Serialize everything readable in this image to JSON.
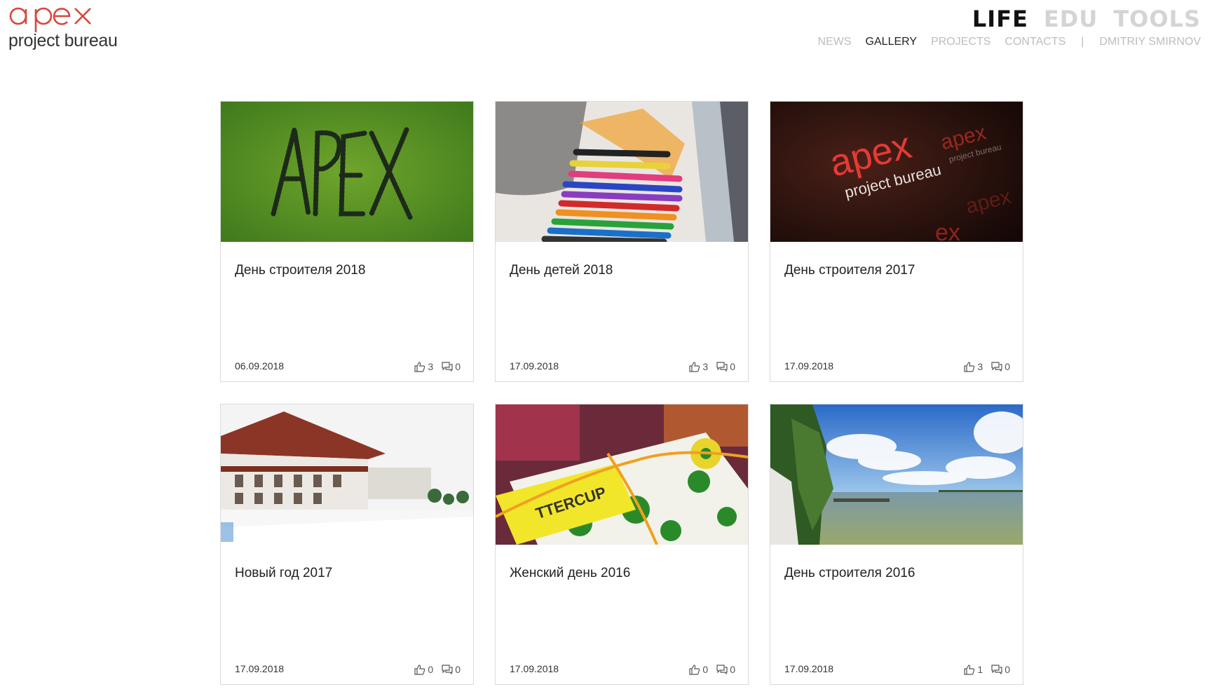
{
  "logo": {
    "mark": "apex",
    "sub": "project bureau"
  },
  "sections": [
    "LIFE",
    "EDU",
    "TOOLS"
  ],
  "active_section": "LIFE",
  "subnav": [
    "NEWS",
    "GALLERY",
    "PROJECTS",
    "CONTACTS"
  ],
  "subnav_separator": "|",
  "user": "DMITRIY SMIRNOV",
  "cards": [
    {
      "title": "День строителя 2018",
      "date": "06.09.2018",
      "likes": "3",
      "comments": "0",
      "image": "apex-people-on-grass"
    },
    {
      "title": "День детей 2018",
      "date": "17.09.2018",
      "likes": "3",
      "comments": "0",
      "image": "colored-markers"
    },
    {
      "title": "День строителя 2017",
      "date": "17.09.2018",
      "likes": "3",
      "comments": "0",
      "image": "apex-banner-red"
    },
    {
      "title": "Новый год 2017",
      "date": "17.09.2018",
      "likes": "0",
      "comments": "0",
      "image": "snowy-building"
    },
    {
      "title": "Женский день 2016",
      "date": "17.09.2018",
      "likes": "0",
      "comments": "0",
      "image": "gift-box-yellow-tag"
    },
    {
      "title": "День строителя 2016",
      "date": "17.09.2018",
      "likes": "1",
      "comments": "0",
      "image": "lake-sky"
    }
  ],
  "colors": {
    "brand_red": "#d9463d",
    "active": "#111111",
    "inactive": "#cfcfcf"
  }
}
